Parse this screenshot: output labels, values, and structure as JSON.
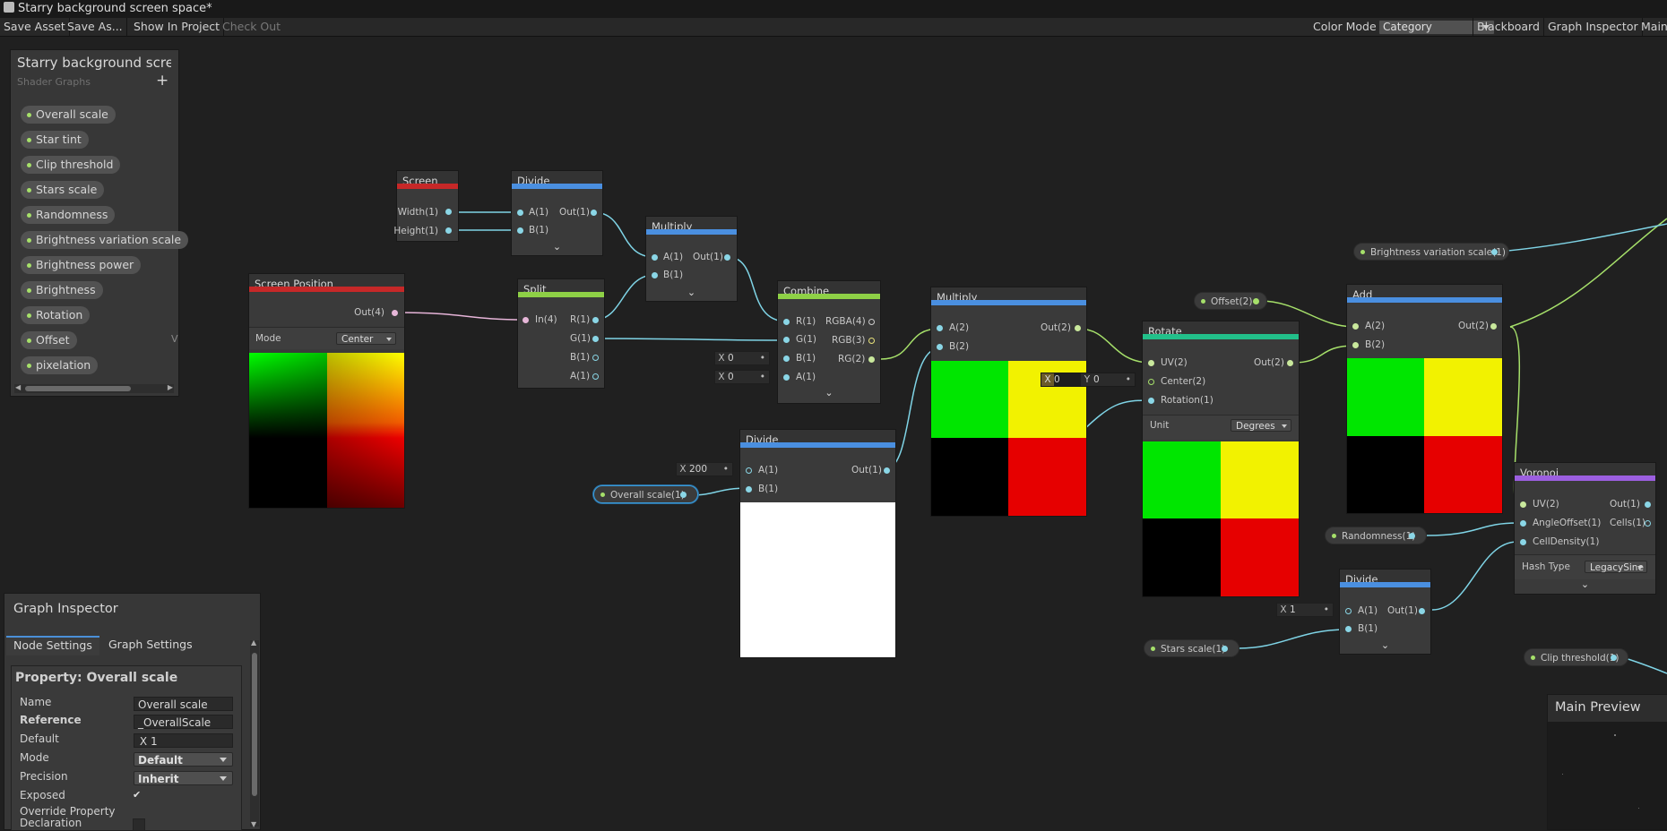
{
  "window": {
    "title": "Starry background screen space*"
  },
  "toolbar": {
    "save_asset": "Save Asset",
    "save_as": "Save As...",
    "show_in_project": "Show In Project",
    "check_out": "Check Out",
    "color_mode_label": "Color Mode",
    "color_mode_value": "Category",
    "blackboard": "Blackboard",
    "graph_inspector": "Graph Inspector",
    "main_preview": "Main Preview"
  },
  "blackboard": {
    "title": "Starry background screen space",
    "subtitle": "Shader Graphs",
    "add": "+",
    "overflow_marker": "V",
    "properties": [
      "Overall scale",
      "Star tint",
      "Clip threshold",
      "Stars scale",
      "Randomness",
      "Brightness variation scale",
      "Brightness power",
      "Brightness",
      "Rotation",
      "Offset",
      "pixelation"
    ]
  },
  "nodes": {
    "screen": {
      "title": "Screen",
      "out1": "Width(1)",
      "out2": "Height(1)"
    },
    "divide1": {
      "title": "Divide",
      "in1": "A(1)",
      "in2": "B(1)",
      "out": "Out(1)"
    },
    "multiply1": {
      "title": "Multiply",
      "in1": "A(1)",
      "in2": "B(1)",
      "out": "Out(1)"
    },
    "screen_position": {
      "title": "Screen Position",
      "out": "Out(4)",
      "mode_label": "Mode",
      "mode_value": "Center"
    },
    "split": {
      "title": "Split",
      "in": "In(4)",
      "out_r": "R(1)",
      "out_g": "G(1)",
      "out_b": "B(1)",
      "out_a": "A(1)"
    },
    "combine": {
      "title": "Combine",
      "in_r": "R(1)",
      "in_g": "G(1)",
      "in_b": "B(1)",
      "in_a": "A(1)",
      "out_rgba": "RGBA(4)",
      "out_rgb": "RGB(3)",
      "out_rg": "RG(2)",
      "b_x": "X",
      "b_val": "0",
      "a_x": "X",
      "a_val": "0"
    },
    "multiply2": {
      "title": "Multiply",
      "in1": "A(2)",
      "in2": "B(2)",
      "out": "Out(2)"
    },
    "divide2": {
      "title": "Divide",
      "in1": "A(1)",
      "in2": "B(1)",
      "out": "Out(1)",
      "a_x": "X",
      "a_val": "200"
    },
    "rotate": {
      "title": "Rotate",
      "in1": "UV(2)",
      "in2": "Center(2)",
      "in3": "Rotation(1)",
      "out": "Out(2)",
      "unit_label": "Unit",
      "unit_value": "Degrees",
      "center_x": "X",
      "center_x_val": "0",
      "center_y": "Y",
      "center_y_val": "0"
    },
    "add": {
      "title": "Add",
      "in1": "A(2)",
      "in2": "B(2)",
      "out": "Out(2)"
    },
    "voronoi": {
      "title": "Voronoi",
      "in1": "UV(2)",
      "in2": "AngleOffset(1)",
      "in3": "CellDensity(1)",
      "out1": "Out(1)",
      "out2": "Cells(1)",
      "hash_label": "Hash Type",
      "hash_value": "LegacySine"
    },
    "divide3": {
      "title": "Divide",
      "in1": "A(1)",
      "in2": "B(1)",
      "out": "Out(1)",
      "a_x": "X",
      "a_val": "1"
    }
  },
  "property_nodes": {
    "overall_scale": "Overall scale(1)",
    "brightness_variation_scale": "Brightness variation scale(1)",
    "offset": "Offset(2)",
    "randomness": "Randomness(1)",
    "stars_scale": "Stars scale(1)",
    "clip_threshold": "Clip threshold(1)"
  },
  "inspector": {
    "title": "Graph Inspector",
    "tab_node": "Node Settings",
    "tab_graph": "Graph Settings",
    "section": "Property: Overall scale",
    "name_label": "Name",
    "name_value": "Overall scale",
    "reference_label": "Reference",
    "reference_value": "_OverallScale",
    "default_label": "Default",
    "default_x": "X",
    "default_value": "1",
    "mode_label": "Mode",
    "mode_value": "Default",
    "precision_label": "Precision",
    "precision_value": "Inherit",
    "exposed_label": "Exposed",
    "exposed_check": "✔",
    "override_label": "Override Property Declaration"
  },
  "main_preview": {
    "title": "Main Preview"
  },
  "colors": {
    "cat_red": "#c62828",
    "cat_blue": "#4a8fe0",
    "cat_green": "#8ed046",
    "cat_teal": "#22c08a",
    "cat_purple": "#9c5fe0",
    "wire": "#7fd4e6",
    "wire_vec4": "#e6b4d8",
    "wire_vec2": "#a6e06a"
  }
}
